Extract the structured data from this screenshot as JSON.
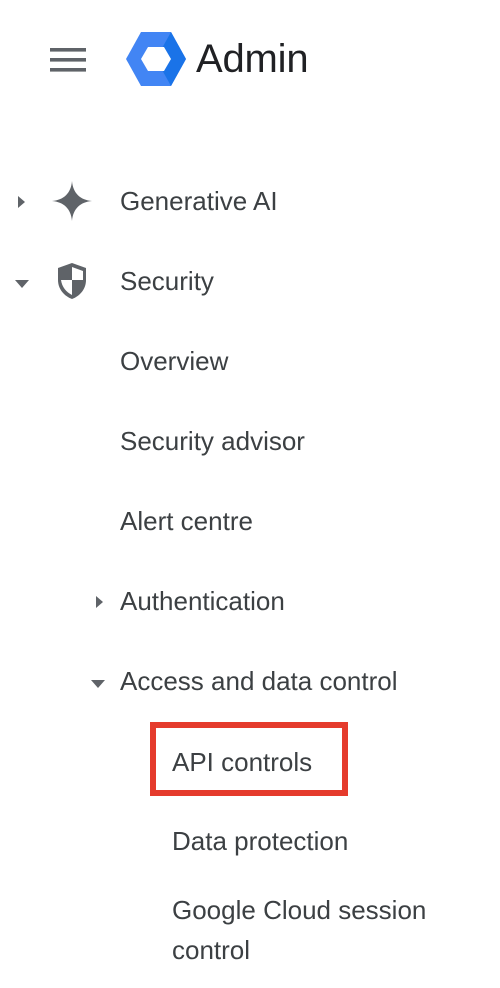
{
  "header": {
    "menu_icon": "hamburger-menu-icon",
    "logo_icon": "admin-hexagon-logo-icon",
    "title": "Admin"
  },
  "nav": {
    "generative_ai": {
      "label": "Generative AI",
      "icon": "sparkle-icon",
      "expanded": false
    },
    "security": {
      "label": "Security",
      "icon": "shield-icon",
      "expanded": true,
      "children": {
        "overview": "Overview",
        "security_advisor": "Security advisor",
        "alert_centre": "Alert centre",
        "authentication": {
          "label": "Authentication",
          "expanded": false
        },
        "access_data_control": {
          "label": "Access and data control",
          "expanded": true,
          "children": {
            "api_controls": {
              "label": "API controls",
              "highlighted": true
            },
            "data_protection": "Data protection",
            "gcloud_session": "Google Cloud session control"
          }
        }
      }
    }
  },
  "colors": {
    "text": "#3c4043",
    "title": "#202124",
    "icon_gray": "#5f6368",
    "highlight": "#e53b2c",
    "logo_blue": "#4285f4",
    "logo_dark_blue": "#1a73e8"
  }
}
